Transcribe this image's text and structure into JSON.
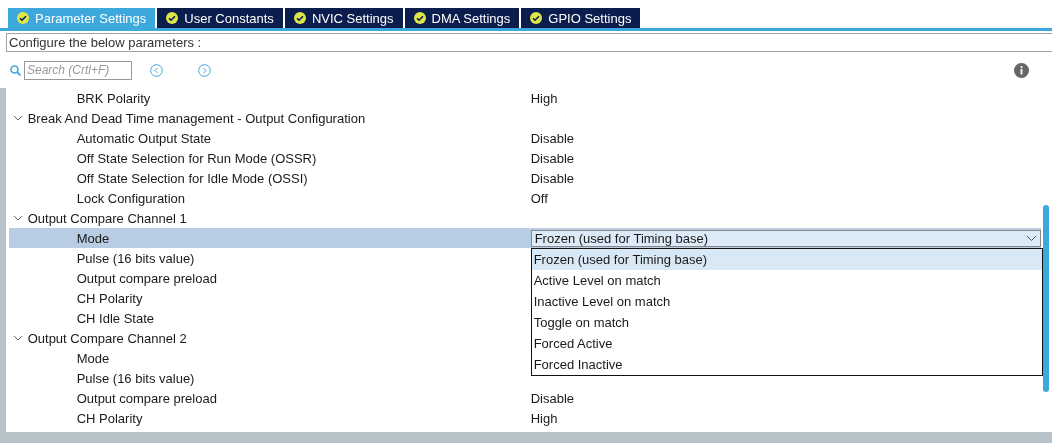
{
  "tabs": [
    {
      "label": "Parameter Settings",
      "selected": true
    },
    {
      "label": "User Constants",
      "selected": false
    },
    {
      "label": "NVIC Settings",
      "selected": false
    },
    {
      "label": "DMA Settings",
      "selected": false
    },
    {
      "label": "GPIO Settings",
      "selected": false
    }
  ],
  "description": "Configure the below parameters :",
  "search": {
    "placeholder": "Search (Crtl+F)"
  },
  "tree": [
    {
      "label": "BRK Polarity",
      "value": "High",
      "selected": false
    },
    {
      "label": "Break And Dead Time management - Output Configuration",
      "expanded": true,
      "children": [
        {
          "label": "Automatic Output State",
          "value": "Disable",
          "selected": false
        },
        {
          "label": "Off State Selection for Run Mode (OSSR)",
          "value": "Disable",
          "selected": false
        },
        {
          "label": "Off State Selection for Idle Mode (OSSI)",
          "value": "Disable",
          "selected": false
        },
        {
          "label": "Lock Configuration",
          "value": "Off",
          "selected": false
        }
      ]
    },
    {
      "label": "Output Compare Channel 1",
      "expanded": true,
      "children": [
        {
          "label": "Mode",
          "selected": true,
          "dropdown": {
            "value": "Frozen (used for Timing base)",
            "open": true,
            "options": [
              {
                "label": "Frozen (used for Timing base)",
                "selected": true
              },
              {
                "label": "Active Level on match",
                "selected": false
              },
              {
                "label": "Inactive Level on match",
                "selected": false
              },
              {
                "label": "Toggle on match",
                "selected": false
              },
              {
                "label": "Forced Active",
                "selected": false
              },
              {
                "label": "Forced Inactive",
                "selected": false
              }
            ]
          }
        },
        {
          "label": "Pulse (16 bits value)",
          "selected": false
        },
        {
          "label": "Output compare preload",
          "selected": false
        },
        {
          "label": "CH Polarity",
          "selected": false
        },
        {
          "label": "CH Idle State",
          "selected": false
        }
      ]
    },
    {
      "label": "Output Compare Channel 2",
      "expanded": true,
      "children": [
        {
          "label": "Mode",
          "selected": false
        },
        {
          "label": "Pulse (16 bits value)",
          "selected": false
        },
        {
          "label": "Output compare preload",
          "value": "Disable",
          "selected": false
        },
        {
          "label": "CH Polarity",
          "value": "High",
          "selected": false
        }
      ]
    }
  ]
}
